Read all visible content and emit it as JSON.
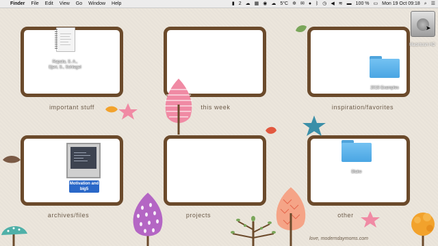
{
  "menubar": {
    "apple_glyph": "",
    "items": [
      "Finder",
      "File",
      "Edit",
      "View",
      "Go",
      "Window",
      "Help"
    ],
    "status": {
      "num1": "2",
      "temp": "5°C",
      "battery": "100 %",
      "datetime": "Mon 19 Oct  09:18",
      "search_icon": "magnifier-icon",
      "menu_icon": "list-icon"
    }
  },
  "frames": {
    "f1_label": "important stuff",
    "f2_label": "this week",
    "f3_label": "inspiration/favorites",
    "f4_label": "archives/files",
    "f5_label": "projects",
    "f6_label": "other"
  },
  "desktop": {
    "doc_label_1": "Rapala, S. A.,",
    "doc_label_2": "Ejeri, S., Schlegel",
    "folder_inspiration": "2015 Examples",
    "folder_other": "Blake",
    "file_selected_1": "Motivation and",
    "file_selected_2": "big5",
    "hd_label": "Macintosh HD"
  },
  "footer": "love, moderndaymoms.com",
  "colors": {
    "frame": "#6b4a2b",
    "background": "#ece6dc",
    "folder": "#5bb1e8",
    "selection": "#2a68c8"
  }
}
